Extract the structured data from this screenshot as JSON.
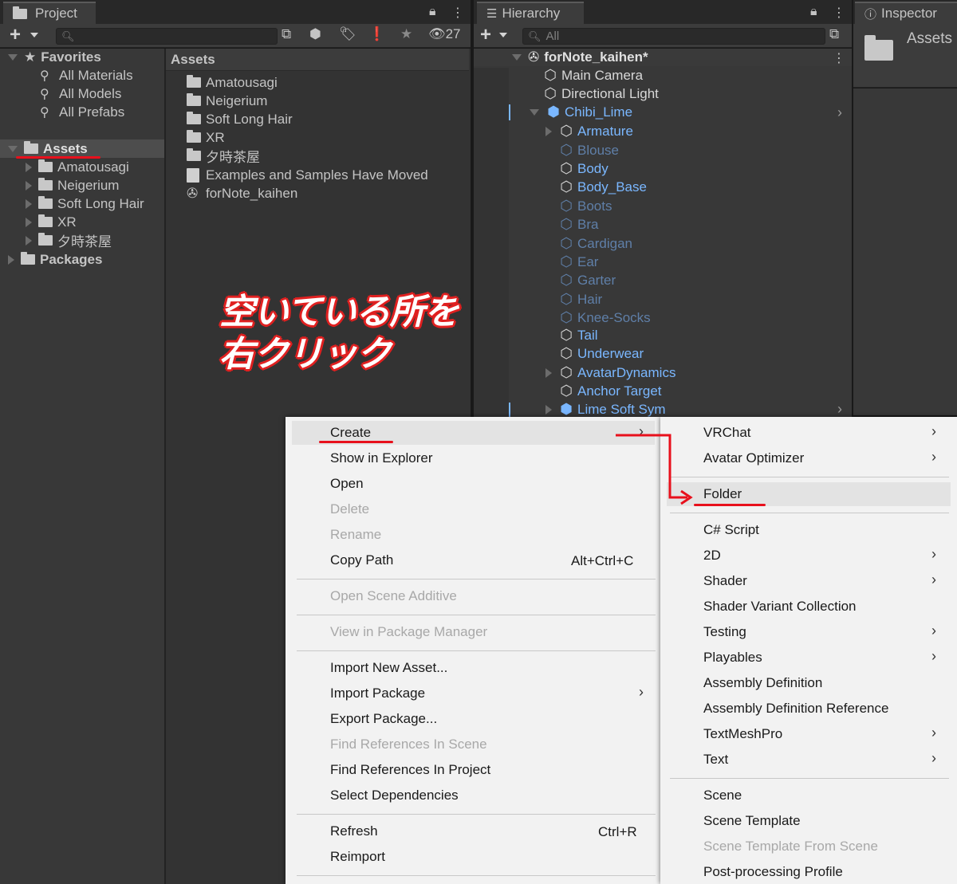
{
  "project": {
    "tab_label": "Project",
    "favorites_label": "Favorites",
    "favorites": [
      "All Materials",
      "All Models",
      "All Prefabs"
    ],
    "assets_label": "Assets",
    "asset_children": [
      "Amatousagi",
      "Neigerium",
      "Soft Long Hair",
      "XR",
      "夕時茶屋"
    ],
    "packages_label": "Packages",
    "hidden_count": "27",
    "main_header": "Assets",
    "main_items": [
      {
        "label": "Amatousagi",
        "icon": "folder-icon"
      },
      {
        "label": "Neigerium",
        "icon": "folder-icon"
      },
      {
        "label": "Soft Long Hair",
        "icon": "folder-icon"
      },
      {
        "label": "XR",
        "icon": "folder-icon"
      },
      {
        "label": "夕時茶屋",
        "icon": "folder-icon"
      },
      {
        "label": "Examples and Samples Have Moved",
        "icon": "document-icon"
      },
      {
        "label": "forNote_kaihen",
        "icon": "unity-scene-icon"
      }
    ]
  },
  "hierarchy": {
    "tab_label": "Hierarchy",
    "search_placeholder": "All",
    "scene_name": "forNote_kaihen*",
    "items": [
      {
        "label": "Main Camera",
        "style": "white"
      },
      {
        "label": "Directional Light",
        "style": "white"
      },
      {
        "label": "Chibi_Lime",
        "style": "blue"
      },
      {
        "label": "Armature",
        "style": "blue"
      },
      {
        "label": "Blouse",
        "style": "dim"
      },
      {
        "label": "Body",
        "style": "blue"
      },
      {
        "label": "Body_Base",
        "style": "blue"
      },
      {
        "label": "Boots",
        "style": "dim"
      },
      {
        "label": "Bra",
        "style": "dim"
      },
      {
        "label": "Cardigan",
        "style": "dim"
      },
      {
        "label": "Ear",
        "style": "dim"
      },
      {
        "label": "Garter",
        "style": "dim"
      },
      {
        "label": "Hair",
        "style": "dim"
      },
      {
        "label": "Knee-Socks",
        "style": "dim"
      },
      {
        "label": "Tail",
        "style": "blue"
      },
      {
        "label": "Underwear",
        "style": "blue"
      },
      {
        "label": "AvatarDynamics",
        "style": "blue"
      },
      {
        "label": "Anchor Target",
        "style": "blue"
      },
      {
        "label": "Lime Soft Sym",
        "style": "blue"
      }
    ]
  },
  "inspector": {
    "tab_label": "Inspector",
    "title": "Assets"
  },
  "annotation": {
    "line1": "空いている所を",
    "line2": "右クリック"
  },
  "context_menu": {
    "items": [
      {
        "label": "Create",
        "submenu": true
      },
      {
        "label": "Show in Explorer"
      },
      {
        "label": "Open"
      },
      {
        "label": "Delete",
        "disabled": true
      },
      {
        "label": "Rename",
        "disabled": true
      },
      {
        "label": "Copy Path",
        "shortcut": "Alt+Ctrl+C"
      },
      {
        "label": "Open Scene Additive",
        "disabled": true
      },
      {
        "label": "View in Package Manager",
        "disabled": true
      },
      {
        "label": "Import New Asset..."
      },
      {
        "label": "Import Package",
        "submenu": true
      },
      {
        "label": "Export Package..."
      },
      {
        "label": "Find References In Scene",
        "disabled": true
      },
      {
        "label": "Find References In Project"
      },
      {
        "label": "Select Dependencies"
      },
      {
        "label": "Refresh",
        "shortcut": "Ctrl+R"
      },
      {
        "label": "Reimport"
      }
    ]
  },
  "create_submenu": {
    "items": [
      {
        "label": "VRChat",
        "submenu": true
      },
      {
        "label": "Avatar Optimizer",
        "submenu": true
      },
      {
        "label": "Folder"
      },
      {
        "label": "C# Script"
      },
      {
        "label": "2D",
        "submenu": true
      },
      {
        "label": "Shader",
        "submenu": true
      },
      {
        "label": "Shader Variant Collection"
      },
      {
        "label": "Testing",
        "submenu": true
      },
      {
        "label": "Playables",
        "submenu": true
      },
      {
        "label": "Assembly Definition"
      },
      {
        "label": "Assembly Definition Reference"
      },
      {
        "label": "TextMeshPro",
        "submenu": true
      },
      {
        "label": "Text",
        "submenu": true
      },
      {
        "label": "Scene"
      },
      {
        "label": "Scene Template"
      },
      {
        "label": "Scene Template From Scene",
        "disabled": true
      },
      {
        "label": "Post-processing Profile"
      }
    ]
  },
  "colors": {
    "annotation_red": "#e8101c",
    "prefab_blue": "#7ab7ff",
    "disabled_prefab": "#5f7fa8",
    "menu_bg": "#f2f2f2"
  }
}
